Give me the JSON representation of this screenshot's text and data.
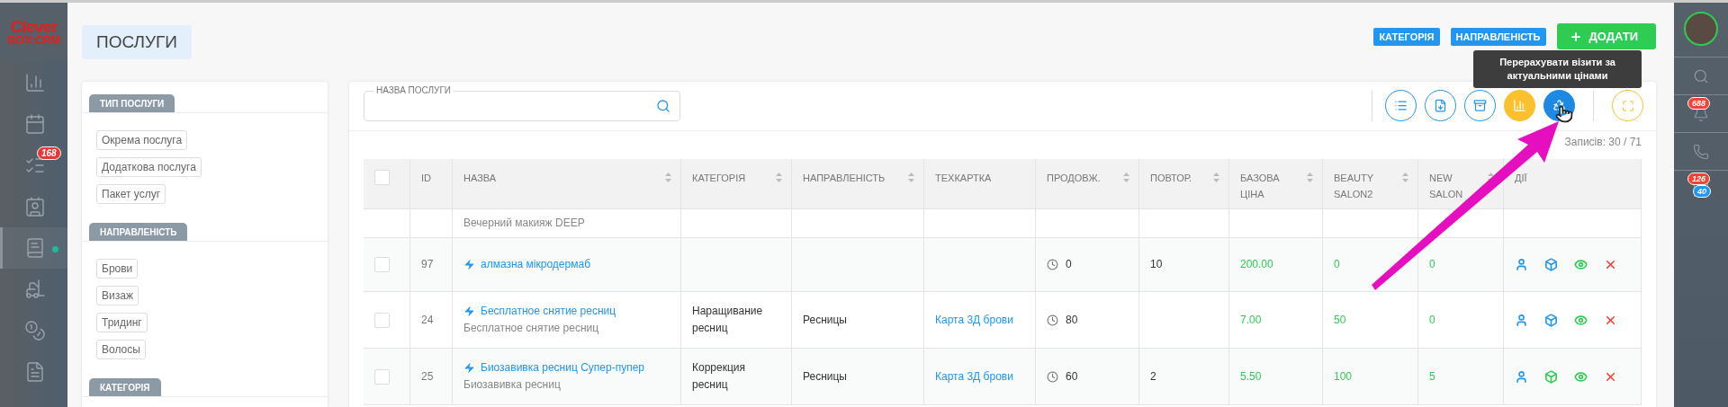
{
  "logo": {
    "line1": "Clever",
    "line2": "BOX:CRM"
  },
  "left_rail": [
    {
      "kind": "chart",
      "selected": false
    },
    {
      "kind": "calendar",
      "selected": false
    },
    {
      "kind": "tasks",
      "selected": false,
      "badge": "168"
    },
    {
      "kind": "contacts",
      "selected": false
    },
    {
      "kind": "book",
      "selected": true
    },
    {
      "kind": "forklift",
      "selected": false
    },
    {
      "kind": "coins",
      "selected": false
    },
    {
      "kind": "report",
      "selected": false
    }
  ],
  "page_title": "ПОСЛУГИ",
  "header_buttons": [
    {
      "label": "КАТЕГОРІЯ",
      "kind": "tag"
    },
    {
      "label": "НАПРАВЛЕНІСТЬ",
      "kind": "tag"
    },
    {
      "label": "ДОДАТИ",
      "kind": "add"
    }
  ],
  "tooltip": "Перерахувати візити за актуальними цінами",
  "filters": [
    {
      "title": "ТИП ПОСЛУГИ",
      "chips": [
        "Окрема послуга",
        "Додаткова послуга",
        "Пакет услуг"
      ]
    },
    {
      "title": "НАПРАВЛЕНІСТЬ",
      "chips": [
        "Брови",
        "Визаж",
        "Тридинг",
        "Волосы"
      ]
    },
    {
      "title": "КАТЕГОРІЯ"
    }
  ],
  "search": {
    "label": "НАЗВА ПОСЛУГИ"
  },
  "toolbar": [
    {
      "kind": "columns"
    },
    {
      "kind": "export"
    },
    {
      "kind": "archive"
    },
    {
      "kind": "chart"
    },
    {
      "kind": "recalc"
    }
  ],
  "records": "Записів: 30 / 71",
  "table": {
    "header_checked": false,
    "columns": [
      {
        "label": "ID",
        "sortable": false
      },
      {
        "label": "НАЗВА",
        "sortable": true
      },
      {
        "label": "КАТЕГОРІЯ",
        "sortable": true
      },
      {
        "label": "НАПРАВЛЕНІСТЬ",
        "sortable": true
      },
      {
        "label": "ТЕХКАРТКА",
        "sortable": false
      },
      {
        "label": "ПРОДОВЖ.",
        "sortable": true
      },
      {
        "label": "ПОВТОР.",
        "sortable": true
      },
      {
        "label": "БАЗОВА ЦІНА",
        "sortable": true
      },
      {
        "label": "BEAUTY SALON2",
        "sortable": true
      },
      {
        "label": "NEW SALON",
        "sortable": true
      },
      {
        "label": "ДІЇ",
        "sortable": false
      }
    ],
    "partial_row_text": "Вечерний макияж DEEP",
    "rows": [
      {
        "checked": false,
        "id": "97",
        "name": "алмазна мікродермаб",
        "subtitle": "",
        "category": "",
        "direction": "",
        "techcard": "",
        "duration": "0",
        "repeats": "10",
        "base_price": "200.00",
        "salon2": "0",
        "new_salon": "0",
        "actions": [
          {
            "kind": "client",
            "color": "#2196f3"
          },
          {
            "kind": "box",
            "color": "#2196f3"
          },
          {
            "kind": "view",
            "color": "#2ecc52"
          },
          {
            "kind": "delete",
            "color": "#f44336"
          }
        ]
      },
      {
        "checked": false,
        "id": "24",
        "name": "Бесплатное снятие ресниц",
        "subtitle": "Бесплатное снятие ресниц",
        "category": "Наращивание ресниц",
        "direction": "Ресницы",
        "techcard": "Карта 3Д брови",
        "duration": "80",
        "repeats": "",
        "base_price": "7.00",
        "salon2": "50",
        "new_salon": "0",
        "actions": [
          {
            "kind": "client",
            "color": "#2196f3"
          },
          {
            "kind": "box",
            "color": "#2196f3"
          },
          {
            "kind": "view",
            "color": "#2ecc52"
          },
          {
            "kind": "delete",
            "color": "#f44336"
          }
        ]
      },
      {
        "checked": false,
        "id": "25",
        "name": "Биозавивка ресниц Супер-пупер",
        "subtitle": "Биозавивка ресниц",
        "category": "Коррекция ресниц",
        "direction": "Ресницы",
        "techcard": "Карта 3Д брови",
        "duration": "60",
        "repeats": "2",
        "base_price": "5.50",
        "salon2": "100",
        "new_salon": "5",
        "actions": [
          {
            "kind": "client",
            "color": "#2196f3"
          },
          {
            "kind": "box",
            "color": "#2ecc52"
          },
          {
            "kind": "view",
            "color": "#2ecc52"
          },
          {
            "kind": "delete",
            "color": "#f44336"
          }
        ]
      }
    ]
  },
  "right_rail": [
    {
      "kind": "search"
    },
    {
      "kind": "bell",
      "badges": [
        {
          "text": "688",
          "color": "#f44336"
        }
      ]
    },
    {
      "kind": "phone"
    },
    {
      "kind": "chat",
      "badges": [
        {
          "text": "126",
          "color": "#f44336"
        },
        {
          "text": "40",
          "color": "#2196f3"
        }
      ]
    }
  ]
}
